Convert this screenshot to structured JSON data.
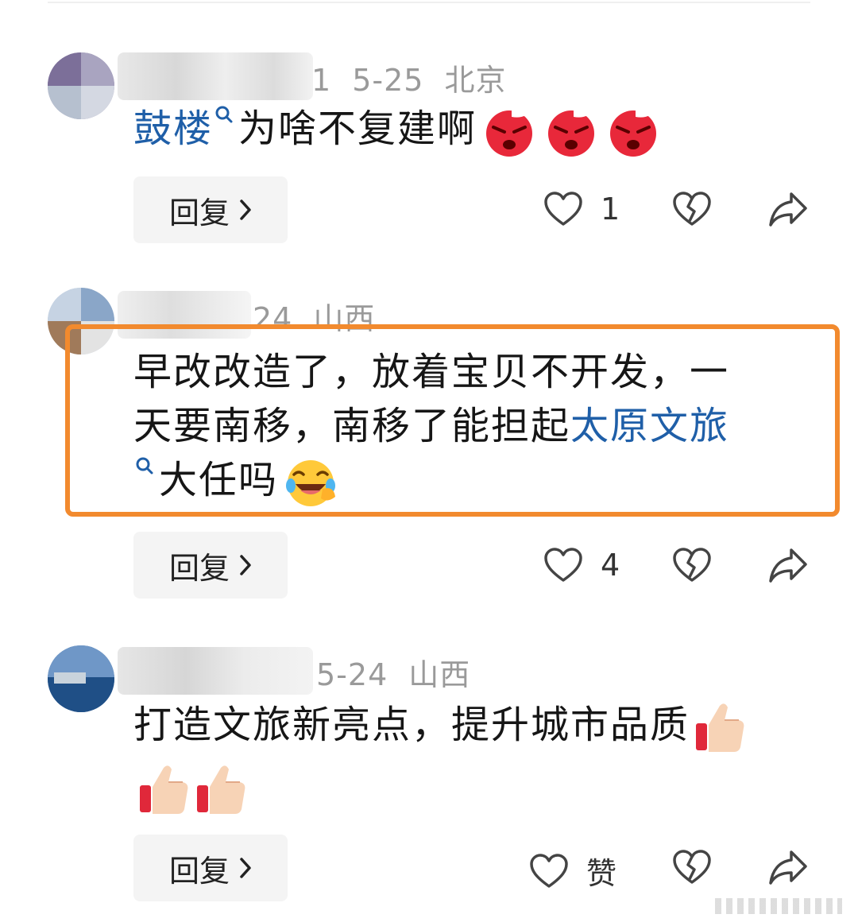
{
  "comments": [
    {
      "meta_tail": "1",
      "date": "5-25",
      "location": "北京",
      "body_link": "鼓楼",
      "body_text": "为啥不复建啊",
      "emoji": [
        "angry-face",
        "angry-face",
        "angry-face"
      ],
      "reply_label": "回复",
      "like_count": "1"
    },
    {
      "meta_tail": "24",
      "location": "山西",
      "body_text_1": "早改改造了，放着宝贝不开发，一",
      "body_text_2a": "天要南移，南移了能担起",
      "body_link": "太原文旅",
      "body_text_3": "大任吗",
      "emoji": [
        "laughing-crying-face"
      ],
      "reply_label": "回复",
      "like_count": "4"
    },
    {
      "date": "5-24",
      "location": "山西",
      "body_text": "打造文旅新亮点，提升城市品质",
      "emoji": [
        "thumbs-up",
        "thumbs-up",
        "thumbs-up"
      ],
      "reply_label": "回复",
      "like_label": "赞"
    }
  ],
  "colors": {
    "link": "#1f5fa8",
    "highlight_border": "#f28a2e",
    "meta_text": "#9a9a9a",
    "reply_bg": "#f4f4f4"
  },
  "icons": {
    "like": "heart-outline-icon",
    "dislike": "broken-heart-icon",
    "share": "share-arrow-icon",
    "search": "search-mini-icon",
    "chevron": "chevron-right-icon"
  }
}
